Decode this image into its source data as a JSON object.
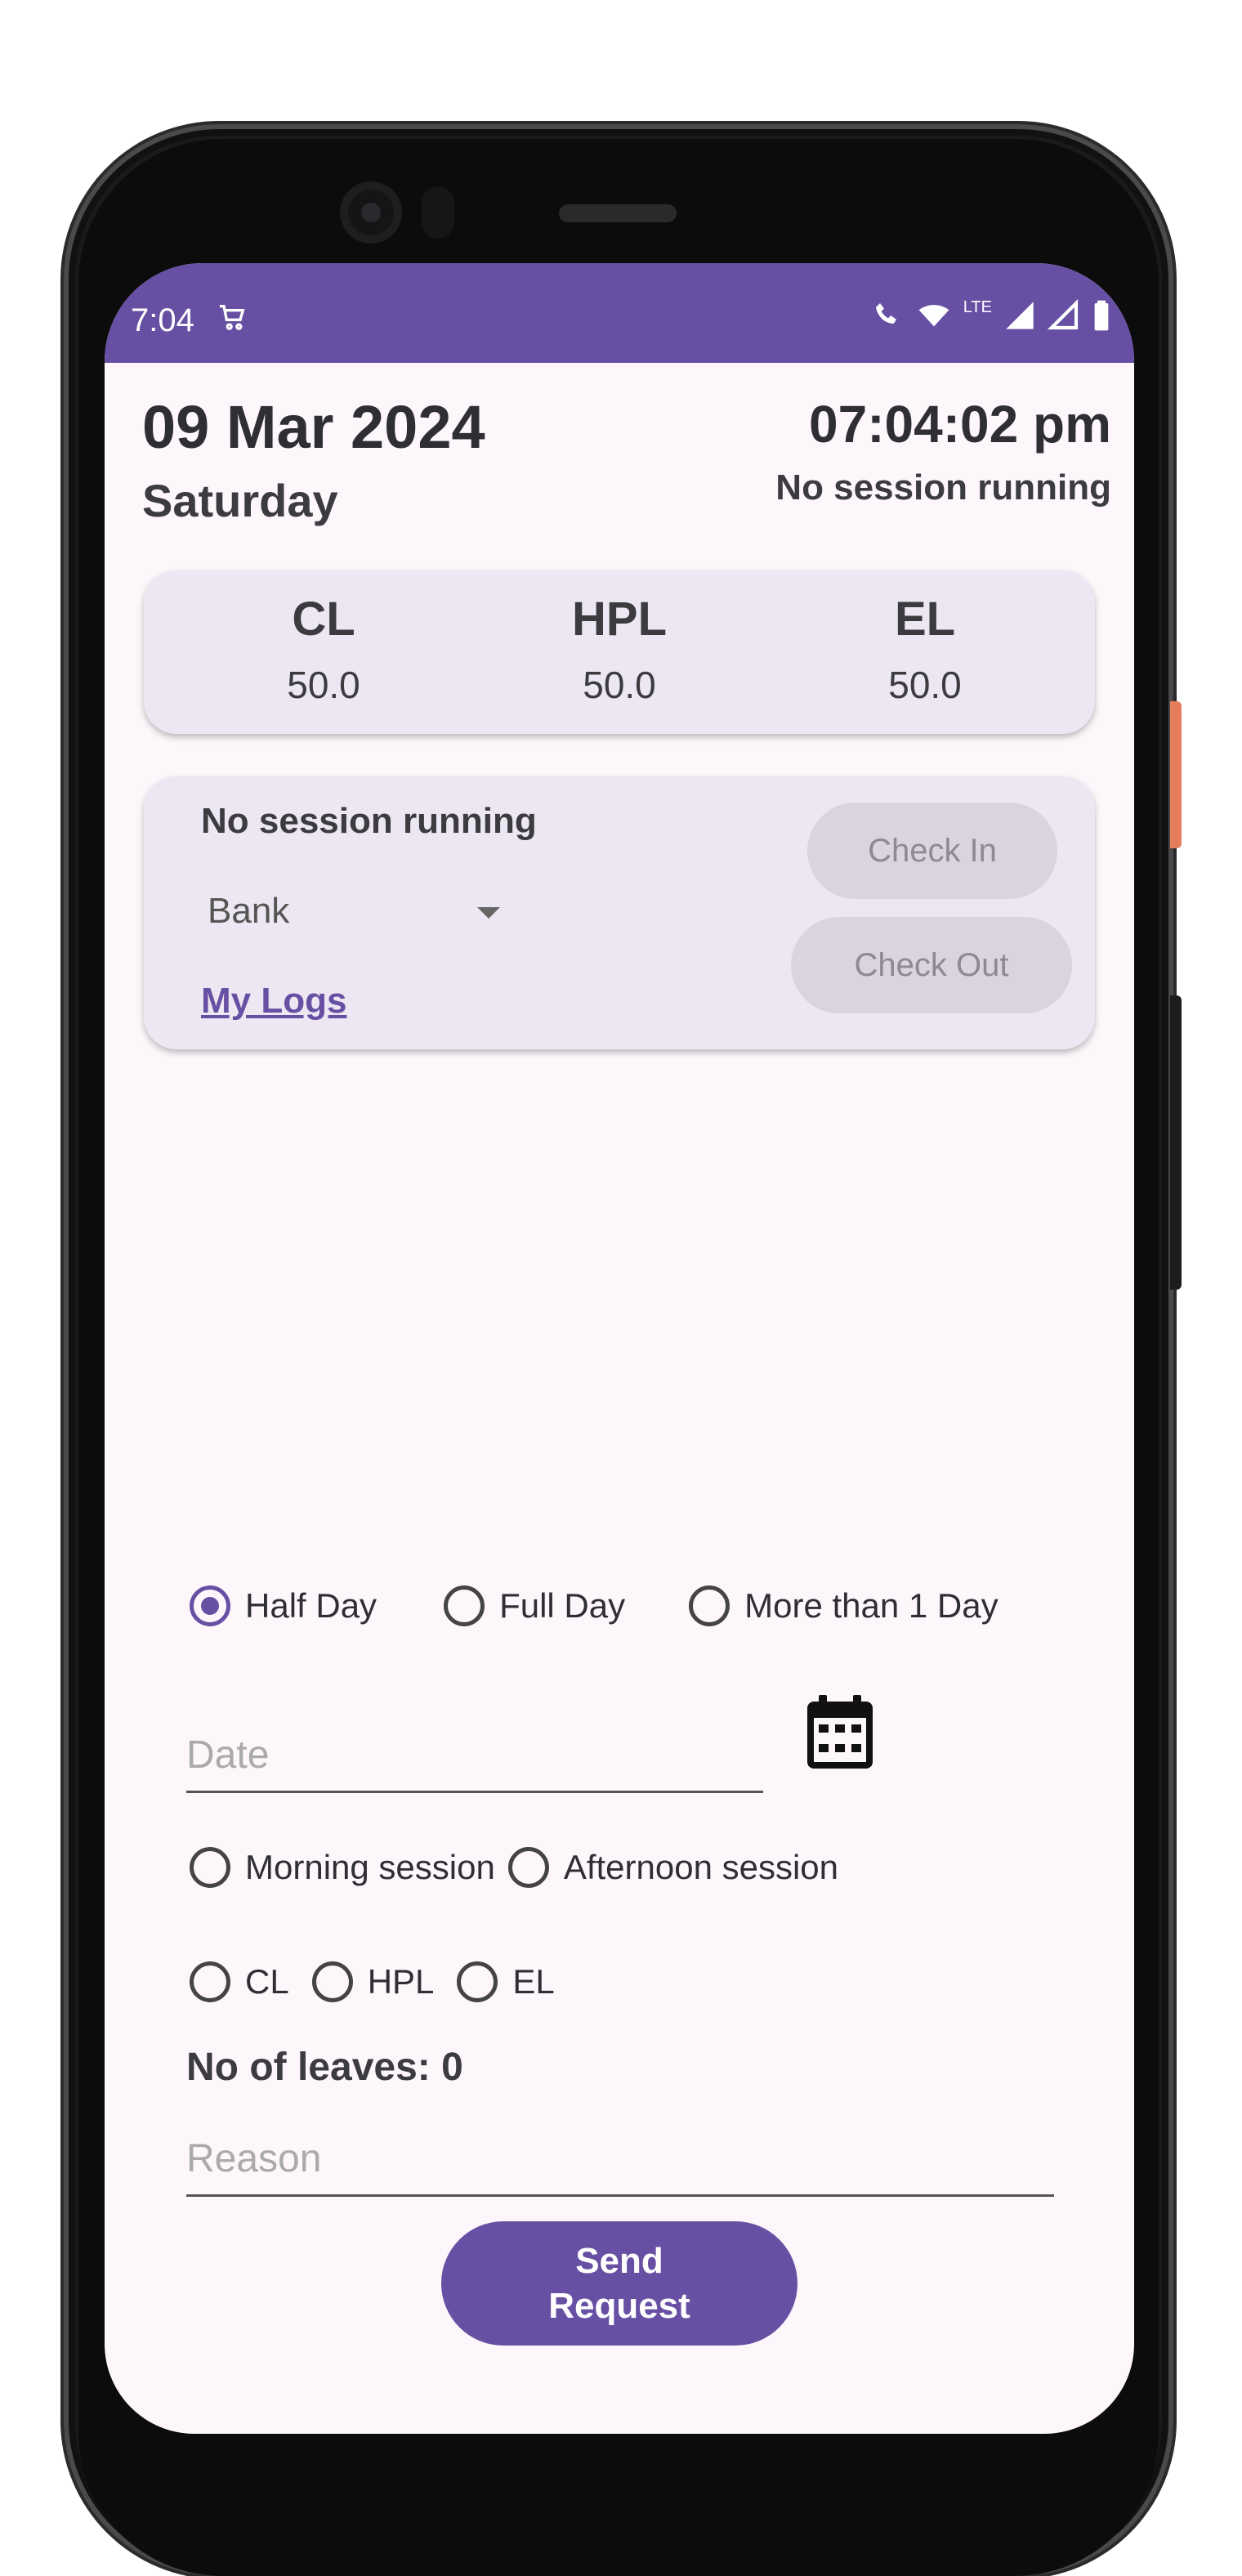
{
  "status_bar": {
    "time": "7:04",
    "lte_label": "LTE"
  },
  "header": {
    "date": "09 Mar 2024",
    "weekday": "Saturday",
    "clock": "07:04:02 pm",
    "session_status": "No session running"
  },
  "balances": [
    {
      "label": "CL",
      "value": "50.0"
    },
    {
      "label": "HPL",
      "value": "50.0"
    },
    {
      "label": "EL",
      "value": "50.0"
    }
  ],
  "session_card": {
    "status": "No session running",
    "location_selected": "Bank",
    "logs_link": "My Logs",
    "check_in": "Check In",
    "check_out": "Check Out"
  },
  "leave_form": {
    "duration_options": [
      "Half Day",
      "Full Day",
      "More than 1 Day"
    ],
    "duration_selected": "Half Day",
    "date_placeholder": "Date",
    "session_options": [
      "Morning session",
      "Afternoon session"
    ],
    "leave_type_options": [
      "CL",
      "HPL",
      "EL"
    ],
    "leaves_count": "No of leaves: 0",
    "reason_placeholder": "Reason",
    "send_line1": "Send",
    "send_line2": "Request"
  },
  "colors": {
    "accent": "#6750a4",
    "card_bg": "#ece7f2",
    "screen_bg": "#fdf7fb",
    "disabled_button": "#d9d4dd"
  }
}
